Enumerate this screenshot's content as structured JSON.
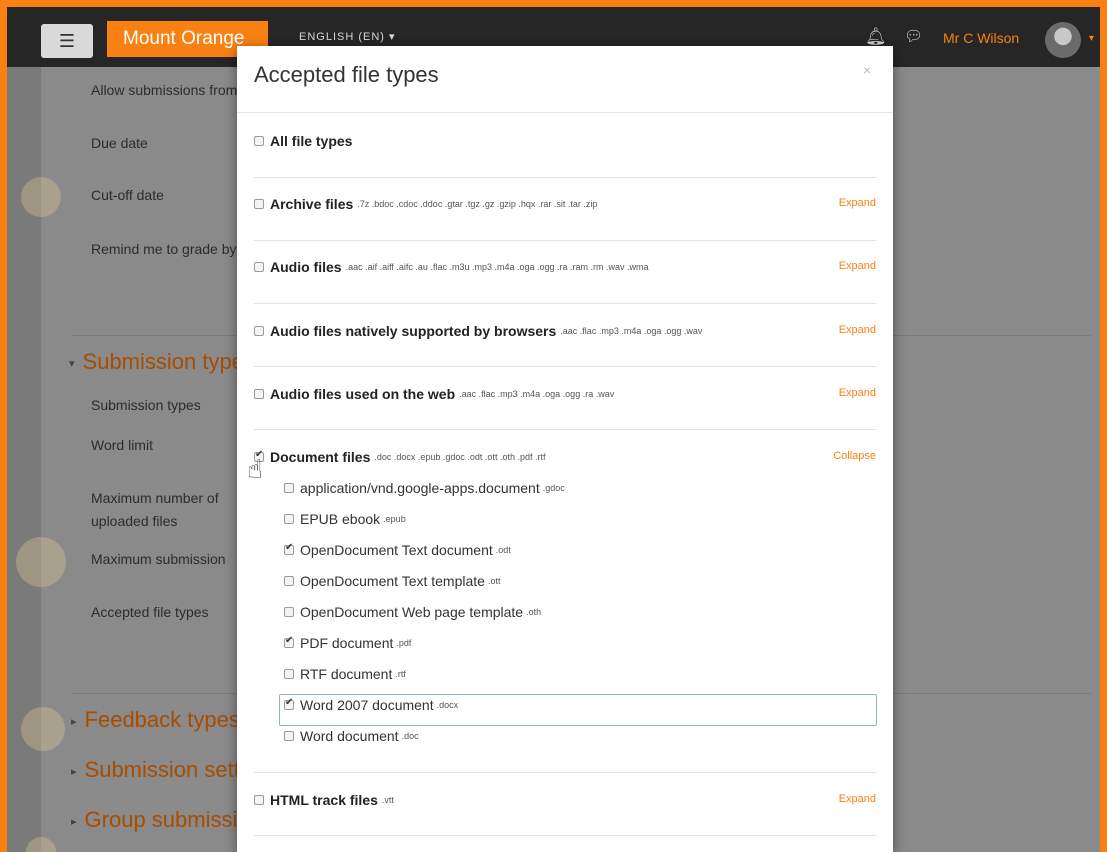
{
  "navbar": {
    "menu_icon": "hamburger-icon",
    "brand": "Mount Orange",
    "language": "ENGLISH (EN)",
    "language_caret": "▾",
    "bell_icon": "bell-icon",
    "chat_icon": "chat-icon",
    "user": "Mr C Wilson",
    "user_caret": "▾"
  },
  "background": {
    "labels": [
      "Allow submissions from",
      "Due date",
      "Cut-off date",
      "Remind me to grade by",
      "Submission types",
      "Word limit",
      "Maximum number of",
      "uploaded files",
      "Maximum submission",
      "Accepted file types"
    ],
    "sections": [
      "Submission types",
      "Feedback types",
      "Submission settings",
      "Group submission settings"
    ],
    "section_expanded_icon": "▾",
    "section_collapsed_icon": "▸"
  },
  "modal": {
    "title": "Accepted file types",
    "close": "×",
    "groups": [
      {
        "title": "All file types",
        "ext": "",
        "link": "",
        "checked": false
      },
      {
        "title": "Archive files",
        "ext": ".7z .bdoc .cdoc .ddoc .gtar .tgz .gz .gzip .hqx .rar .sit .tar .zip",
        "link": "Expand",
        "checked": false
      },
      {
        "title": "Audio files",
        "ext": ".aac .aif .aiff .aifc .au .flac .m3u .mp3 .m4a .oga .ogg .ra .ram .rm .wav .wma",
        "link": "Expand",
        "checked": false
      },
      {
        "title": "Audio files natively supported by browsers",
        "ext": ".aac .flac .mp3 .m4a .oga .ogg .wav",
        "link": "Expand",
        "checked": false
      },
      {
        "title": "Audio files used on the web",
        "ext": ".aac .flac .mp3 .m4a .oga .ogg .ra .wav",
        "link": "Expand",
        "checked": false
      },
      {
        "title": "Document files",
        "ext": ".doc .docx .epub .gdoc .odt .ott .oth .pdf .rtf",
        "link": "Collapse",
        "checked": true
      },
      {
        "title": "HTML track files",
        "ext": ".vtt",
        "link": "Expand",
        "checked": false
      }
    ],
    "document_items": [
      {
        "label": "application/vnd.google-apps.document",
        "ext": ".gdoc",
        "checked": false
      },
      {
        "label": "EPUB ebook",
        "ext": ".epub",
        "checked": false
      },
      {
        "label": "OpenDocument Text document",
        "ext": ".odt",
        "checked": true
      },
      {
        "label": "OpenDocument Text template",
        "ext": ".ott",
        "checked": false
      },
      {
        "label": "OpenDocument Web page template",
        "ext": ".oth",
        "checked": false
      },
      {
        "label": "PDF document",
        "ext": ".pdf",
        "checked": true
      },
      {
        "label": "RTF document",
        "ext": ".rtf",
        "checked": false
      },
      {
        "label": "Word 2007 document",
        "ext": ".docx",
        "checked": true
      },
      {
        "label": "Word document",
        "ext": ".doc",
        "checked": false
      }
    ],
    "cursor_icon": "hand-pointer-icon"
  }
}
